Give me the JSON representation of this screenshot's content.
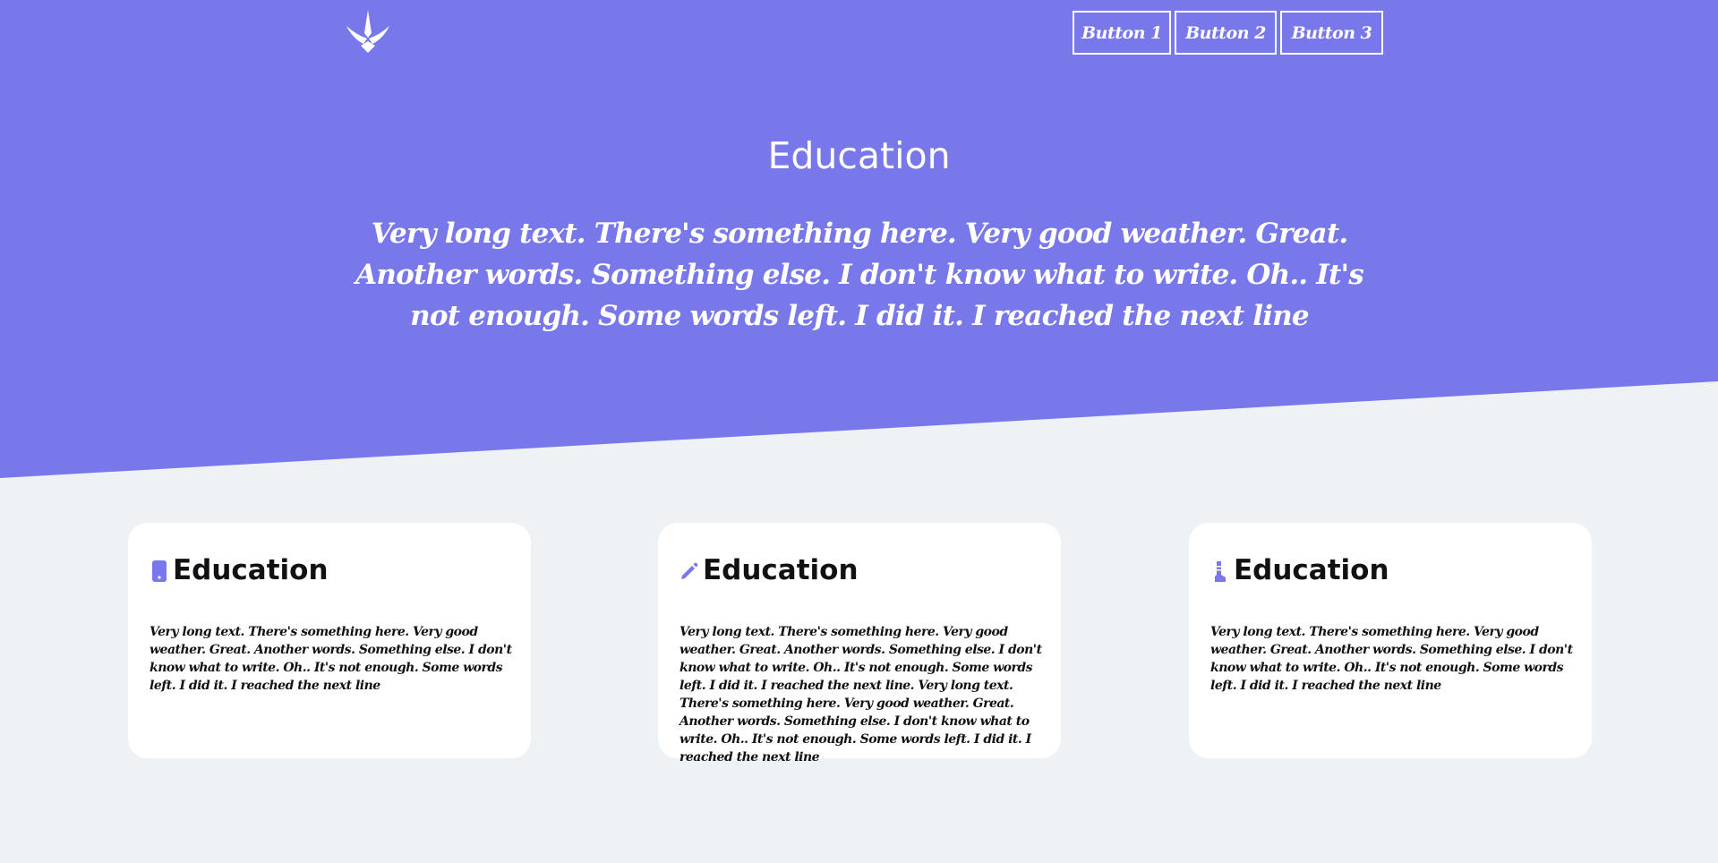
{
  "colors": {
    "hero": "#7878ea",
    "background": "#eef2f5",
    "card": "#ffffff",
    "accent": "#7878ea"
  },
  "header": {
    "logo_icon": "bird-logo-icon",
    "buttons": [
      "Button 1",
      "Button 2",
      "Button 3"
    ]
  },
  "hero": {
    "title": "Education",
    "text": "Very long text. There's something here. Very good weather. Great. Another words. Something else. I don't know what to write. Oh.. It's not enough. Some words left. I did it. I reached the next line"
  },
  "cards": [
    {
      "icon": "mobile-phone-icon",
      "title": "Education",
      "text": "Very long text. There's something here. Very good weather. Great. Another words. Something else. I don't know what to write. Oh.. It's not enough. Some words left. I did it. I reached the next line"
    },
    {
      "icon": "pencil-icon",
      "title": "Education",
      "text": "Very long text. There's something here. Very good weather. Great. Another words. Something else. I don't know what to write. Oh.. It's not enough. Some words left. I did it. I reached the next line. Very long text. There's something here. Very good weather. Great. Another words. Something else. I don't know what to write. Oh.. It's not enough. Some words left. I did it. I reached the next line"
    },
    {
      "icon": "boot-icon",
      "title": "Education",
      "text": "Very long text. There's something here. Very good weather. Great. Another words. Something else. I don't know what to write. Oh.. It's not enough. Some words left. I did it. I reached the next line"
    }
  ]
}
